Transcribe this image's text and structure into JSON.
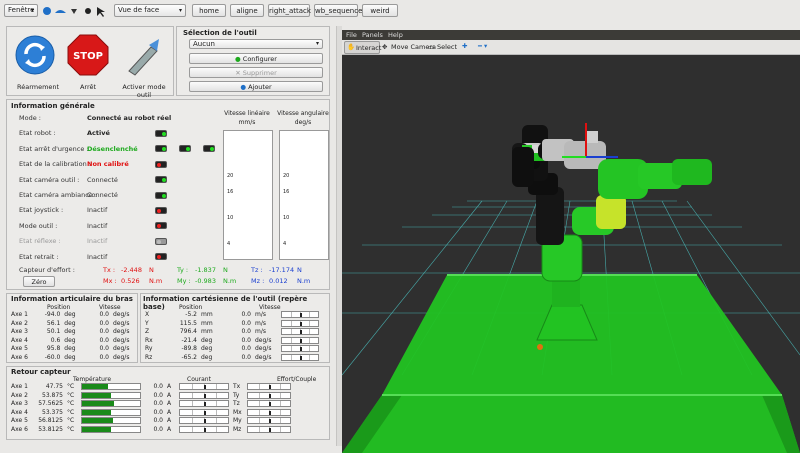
{
  "toolbar": {
    "window_combo": "Fenêtre",
    "view_combo": "Vue de face",
    "buttons": [
      "home",
      "aligne",
      "right_attack",
      "wb_sequence",
      "weird"
    ]
  },
  "actions": {
    "rearm_label": "Réarmement",
    "stop_label": "Arrêt",
    "stop_sign": "STOP",
    "tool_mode_label": "Activer mode outil"
  },
  "tool_selection": {
    "title": "Sélection de l'outil",
    "selected": "Aucun",
    "configure": "Configurer",
    "delete": "Supprimer",
    "add": "Ajouter"
  },
  "general_info": {
    "title": "Information générale",
    "rows": [
      {
        "label": "Mode :",
        "value": "Connecté au robot réel",
        "color": "#222222",
        "bold": true
      },
      {
        "label": "Etat robot :",
        "value": "Activé",
        "color": "#222222",
        "bold": true
      },
      {
        "label": "Etat arrêt d'urgence :",
        "value": "Désenclenché",
        "color": "#1eaa1e",
        "bold": true
      },
      {
        "label": "Etat de la calibration :",
        "value": "Non calibré",
        "color": "#e01010",
        "bold": true
      },
      {
        "label": "Etat caméra outil :",
        "value": "Connecté",
        "color": "#333333",
        "bold": false
      },
      {
        "label": "Etat caméra ambiance :",
        "value": "Connecté",
        "color": "#333333",
        "bold": false
      },
      {
        "label": "Etat joystick :",
        "value": "Inactif",
        "color": "#333333",
        "bold": false
      },
      {
        "label": "Mode outil :",
        "value": "Inactif",
        "color": "#333333",
        "bold": false
      },
      {
        "label": "Etat réflexe :",
        "value": "Inactif",
        "color": "#9a9a9a",
        "bold": false
      },
      {
        "label": "Etat retrait :",
        "value": "Inactif",
        "color": "#333333",
        "bold": false
      }
    ],
    "effort_label": "Capteur d'effort :",
    "zero_button": "Zéro",
    "forces": [
      {
        "label": "Tx :",
        "value": "-2.448",
        "unit": "N",
        "color": "#e01010"
      },
      {
        "label": "Ty :",
        "value": "-1.837",
        "unit": "N",
        "color": "#1eaa1e"
      },
      {
        "label": "Tz :",
        "value": "-17.174",
        "unit": "N",
        "color": "#1a3fd0"
      },
      {
        "label": "Mx :",
        "value": "0.526",
        "unit": "N.m",
        "color": "#e01010"
      },
      {
        "label": "My :",
        "value": "-0.983",
        "unit": "N.m",
        "color": "#1eaa1e"
      },
      {
        "label": "Mz :",
        "value": "0.012",
        "unit": "N.m",
        "color": "#1a3fd0"
      }
    ],
    "lin_speed_title": "Vitesse linéaire",
    "lin_speed_unit": "mm/s",
    "ang_speed_title": "Vitesse angulaire",
    "ang_speed_unit": "deg/s",
    "scale_ticks": [
      "20",
      "16",
      "10",
      "4"
    ]
  },
  "joint_info": {
    "title": "Information articulaire du bras",
    "pos_header": "Position",
    "speed_header": "Vitesse",
    "rows": [
      {
        "axis": "Axe 1",
        "pos": "-94.0",
        "speed": "0.0"
      },
      {
        "axis": "Axe 2",
        "pos": "56.1",
        "speed": "0.0"
      },
      {
        "axis": "Axe 3",
        "pos": "50.1",
        "speed": "0.0"
      },
      {
        "axis": "Axe 4",
        "pos": "0.6",
        "speed": "0.0"
      },
      {
        "axis": "Axe 5",
        "pos": "95.8",
        "speed": "0.0"
      },
      {
        "axis": "Axe 6",
        "pos": "-60.0",
        "speed": "0.0"
      }
    ],
    "pos_unit": "deg",
    "speed_unit": "deg/s"
  },
  "cart_info": {
    "title": "Information cartésienne de l'outil (repère base)",
    "pos_header": "Position",
    "speed_header": "Vitesse",
    "rows": [
      {
        "axis": "X",
        "pos": "-5.2",
        "pu": "mm",
        "speed": "0.0",
        "su": "m/s",
        "mk": 0.5
      },
      {
        "axis": "Y",
        "pos": "115.5",
        "pu": "mm",
        "speed": "0.0",
        "su": "m/s",
        "mk": 0.5
      },
      {
        "axis": "Z",
        "pos": "796.4",
        "pu": "mm",
        "speed": "0.0",
        "su": "m/s",
        "mk": 0.5
      },
      {
        "axis": "Rx",
        "pos": "-21.4",
        "pu": "deg",
        "speed": "0.0",
        "su": "deg/s",
        "mk": 0.5
      },
      {
        "axis": "Ry",
        "pos": "-89.8",
        "pu": "deg",
        "speed": "0.0",
        "su": "deg/s",
        "mk": 0.5
      },
      {
        "axis": "Rz",
        "pos": "-65.2",
        "pu": "deg",
        "speed": "0.0",
        "su": "deg/s",
        "mk": 0.5
      }
    ]
  },
  "sensor_feedback": {
    "title": "Retour capteur",
    "temp_header": "Température",
    "current_header": "Courant",
    "effort_header": "Effort/Couple",
    "rows": [
      {
        "axis": "Axe 1",
        "temp": "47.75",
        "tfill": 0.45,
        "current": "0.0",
        "eff": "Tx"
      },
      {
        "axis": "Axe 2",
        "temp": "53.875",
        "tfill": 0.5,
        "current": "0.0",
        "eff": "Ty"
      },
      {
        "axis": "Axe 3",
        "temp": "57.5625",
        "tfill": 0.55,
        "current": "0.0",
        "eff": "Tz"
      },
      {
        "axis": "Axe 4",
        "temp": "53.375",
        "tfill": 0.5,
        "current": "0.0",
        "eff": "Mx"
      },
      {
        "axis": "Axe 5",
        "temp": "56.8125",
        "tfill": 0.54,
        "current": "0.0",
        "eff": "My"
      },
      {
        "axis": "Axe 6",
        "temp": "53.8125",
        "tfill": 0.5,
        "current": "0.0",
        "eff": "Mz"
      }
    ],
    "temp_unit": "°C",
    "current_unit": "A"
  },
  "rviz": {
    "menu": [
      "File",
      "Panels",
      "Help"
    ],
    "tools": [
      "Interact",
      "Move Camera",
      "Select"
    ]
  },
  "colors": {
    "green_led": "#22dd22",
    "red_led": "#ee2222",
    "stop_red": "#d81818",
    "viewport_bg": "#2f2f2f",
    "ground_green": "#22c322"
  }
}
